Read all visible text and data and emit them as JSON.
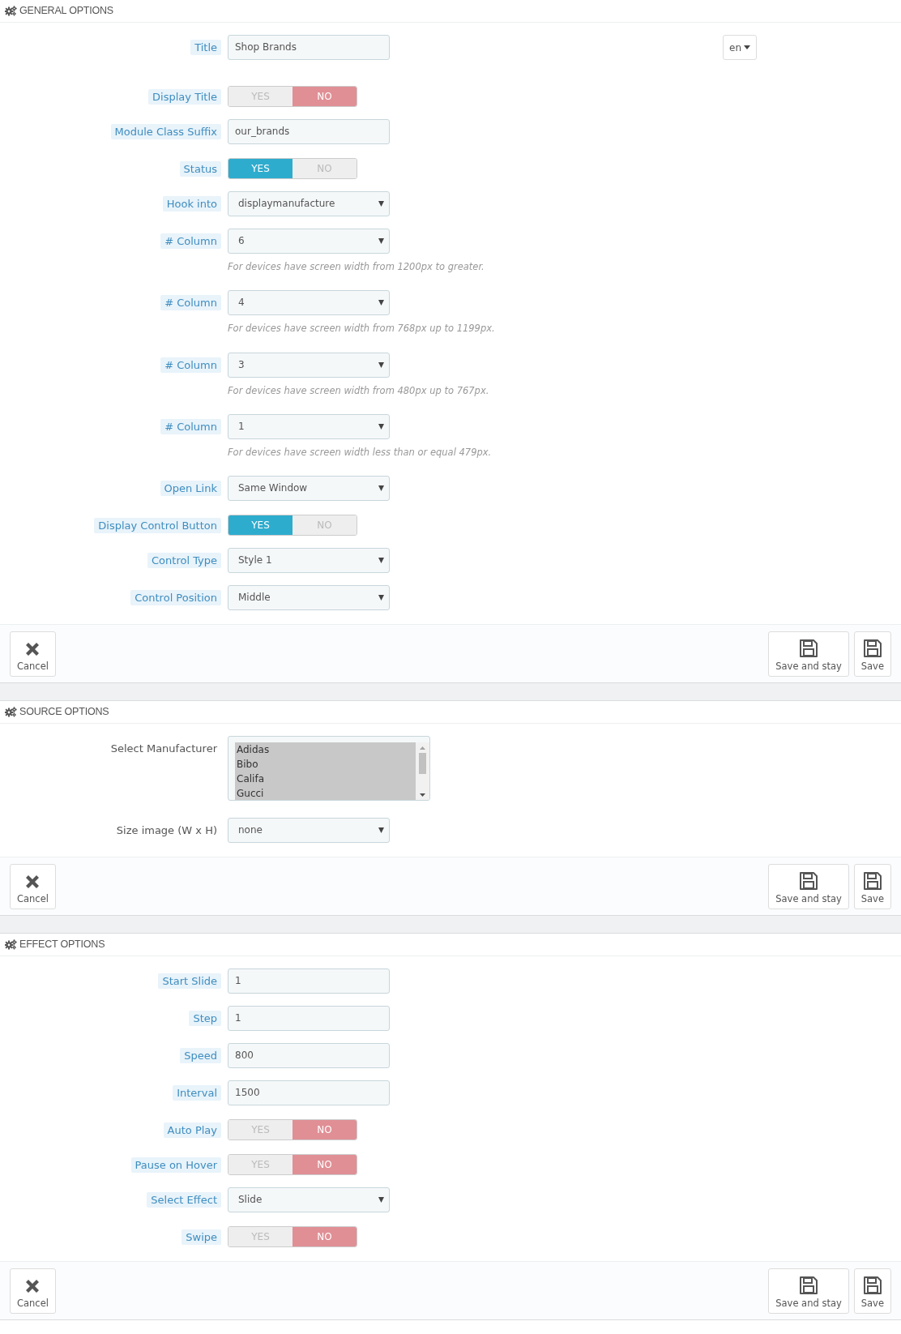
{
  "sections": [
    {
      "title": "GENERAL OPTIONS",
      "fields": [
        {
          "kind": "text",
          "label": "Title",
          "hint": true,
          "value": "Shop Brands",
          "language": "en"
        },
        {
          "kind": "toggle",
          "label": "Display Title",
          "hint": true,
          "yes": "YES",
          "no": "NO",
          "on": false
        },
        {
          "kind": "text",
          "label": "Module Class Suffix",
          "hint": true,
          "value": "our_brands"
        },
        {
          "kind": "toggle",
          "label": "Status",
          "hint": true,
          "yes": "YES",
          "no": "NO",
          "on": true
        },
        {
          "kind": "select",
          "label": "Hook into",
          "hint": true,
          "value": "displaymanufacture"
        },
        {
          "kind": "select",
          "label": "# Column",
          "hint": true,
          "value": "6",
          "help": "For devices have screen width from 1200px to greater."
        },
        {
          "kind": "select",
          "label": "# Column",
          "hint": true,
          "value": "4",
          "help": "For devices have screen width from 768px up to 1199px."
        },
        {
          "kind": "select",
          "label": "# Column",
          "hint": true,
          "value": "3",
          "help": "For devices have screen width from 480px up to 767px."
        },
        {
          "kind": "select",
          "label": "# Column",
          "hint": true,
          "value": "1",
          "help": "For devices have screen width less than or equal 479px."
        },
        {
          "kind": "select",
          "label": "Open Link",
          "hint": true,
          "value": "Same Window"
        },
        {
          "kind": "toggle",
          "label": "Display Control Button",
          "hint": true,
          "yes": "YES",
          "no": "NO",
          "on": true
        },
        {
          "kind": "select",
          "label": "Control Type",
          "hint": true,
          "value": "Style 1"
        },
        {
          "kind": "select",
          "label": "Control Position",
          "hint": true,
          "value": "Middle"
        }
      ],
      "buttons": [
        {
          "kind": "cancel",
          "label": "Cancel"
        },
        {
          "kind": "save",
          "label": "Save and stay"
        },
        {
          "kind": "save",
          "label": "Save"
        }
      ]
    },
    {
      "title": "SOURCE OPTIONS",
      "fields": [
        {
          "kind": "listbox",
          "label": "Select Manufacturer",
          "hint": false,
          "items": [
            {
              "label": "Adidas",
              "selected": true
            },
            {
              "label": "Bibo",
              "selected": true
            },
            {
              "label": "Califa",
              "selected": true
            },
            {
              "label": "Gucci",
              "selected": true
            }
          ]
        },
        {
          "kind": "select",
          "label": "Size image (W x H)",
          "hint": false,
          "value": "none"
        }
      ],
      "buttons": [
        {
          "kind": "cancel",
          "label": "Cancel"
        },
        {
          "kind": "save",
          "label": "Save and stay"
        },
        {
          "kind": "save",
          "label": "Save"
        }
      ]
    },
    {
      "title": "EFFECT OPTIONS",
      "fields": [
        {
          "kind": "text",
          "label": "Start Slide",
          "hint": true,
          "value": "1"
        },
        {
          "kind": "text",
          "label": "Step",
          "hint": true,
          "value": "1"
        },
        {
          "kind": "text",
          "label": "Speed",
          "hint": true,
          "value": "800"
        },
        {
          "kind": "text",
          "label": "Interval",
          "hint": true,
          "value": "1500"
        },
        {
          "kind": "toggle",
          "label": "Auto Play",
          "hint": true,
          "yes": "YES",
          "no": "NO",
          "on": false
        },
        {
          "kind": "toggle",
          "label": "Pause on Hover",
          "hint": true,
          "yes": "YES",
          "no": "NO",
          "on": false
        },
        {
          "kind": "select",
          "label": "Select Effect",
          "hint": true,
          "value": "Slide"
        },
        {
          "kind": "toggle",
          "label": "Swipe",
          "hint": true,
          "yes": "YES",
          "no": "NO",
          "on": false
        }
      ],
      "buttons": [
        {
          "kind": "cancel",
          "label": "Cancel"
        },
        {
          "kind": "save",
          "label": "Save and stay"
        },
        {
          "kind": "save",
          "label": "Save"
        }
      ]
    }
  ]
}
